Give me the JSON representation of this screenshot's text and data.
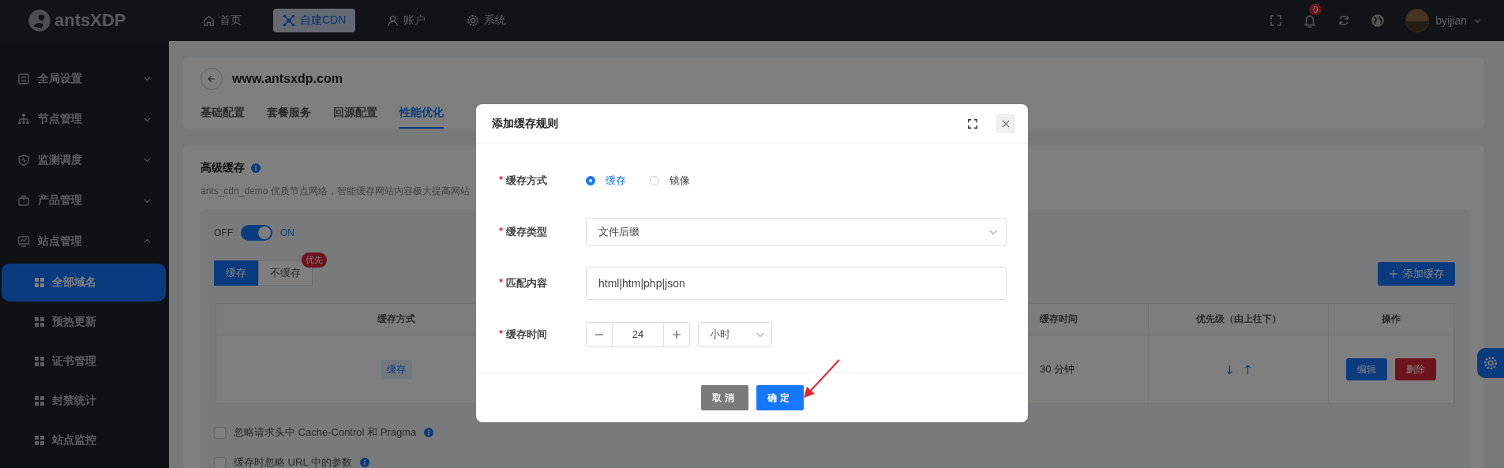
{
  "top_bar": {
    "logo": "antsXDP",
    "nav": [
      {
        "label": "首页",
        "selected": false
      },
      {
        "label": "自建CDN",
        "selected": true
      },
      {
        "label": "账户",
        "selected": false
      },
      {
        "label": "系统",
        "selected": false
      }
    ],
    "notification_count": "0",
    "user": "byijian"
  },
  "sidebar": {
    "items": [
      {
        "label": "全局设置",
        "expanded": false
      },
      {
        "label": "节点管理",
        "expanded": false
      },
      {
        "label": "监测调度",
        "expanded": false
      },
      {
        "label": "产品管理",
        "expanded": false
      },
      {
        "label": "站点管理",
        "expanded": true,
        "children": [
          {
            "label": "全部域名",
            "selected": true
          },
          {
            "label": "预热更新",
            "selected": false
          },
          {
            "label": "证书管理",
            "selected": false
          },
          {
            "label": "封禁统计",
            "selected": false
          },
          {
            "label": "站点监控",
            "selected": false
          }
        ]
      }
    ]
  },
  "site": {
    "domain": "www.antsxdp.com",
    "tabs": [
      {
        "label": "基础配置",
        "selected": false
      },
      {
        "label": "套餐服务",
        "selected": false
      },
      {
        "label": "回源配置",
        "selected": false
      },
      {
        "label": "性能优化",
        "selected": true
      }
    ]
  },
  "advanced_cache": {
    "title": "高级缓存",
    "description": "ants_cdn_demo 优质节点网络，智能缓存网站内容极大提高网站",
    "toggle": {
      "off_label": "OFF",
      "on_label": "ON",
      "on": true
    },
    "cache_tabs": [
      {
        "label": "缓存",
        "selected": true
      },
      {
        "label": "不缓存",
        "selected": false
      }
    ],
    "priority_badge": "优先",
    "add_button": "添加缓存",
    "table": {
      "columns": [
        "缓存方式",
        "缓存时间",
        "优先级（由上往下）",
        "操作"
      ],
      "rows": [
        {
          "mode": "缓存",
          "time": "30 分钟",
          "actions": [
            "编辑",
            "删除"
          ]
        }
      ]
    },
    "options": [
      {
        "label": "忽略请求头中 Cache-Control 和 Pragma",
        "checked": false
      },
      {
        "label": "缓存时忽略 URL 中的参数",
        "checked": false
      }
    ]
  },
  "dialog": {
    "title": "添加缓存规则",
    "fields": [
      {
        "kind": "radio",
        "mark": "*",
        "label": "缓存方式",
        "options": [
          {
            "label": "缓存",
            "selected": true
          },
          {
            "label": "镜像",
            "selected": false
          }
        ]
      },
      {
        "kind": "select",
        "mark": "*",
        "label": "缓存类型",
        "value": "文件后缀"
      },
      {
        "kind": "text",
        "mark": "*",
        "label": "匹配内容",
        "value": "html|htm|php|json"
      },
      {
        "kind": "number",
        "mark": "*",
        "label": "缓存时间",
        "value": "24",
        "unit": "小时"
      }
    ],
    "buttons": [
      {
        "label": "取消",
        "kind": "secondary"
      },
      {
        "label": "确定",
        "kind": "primary"
      }
    ]
  }
}
